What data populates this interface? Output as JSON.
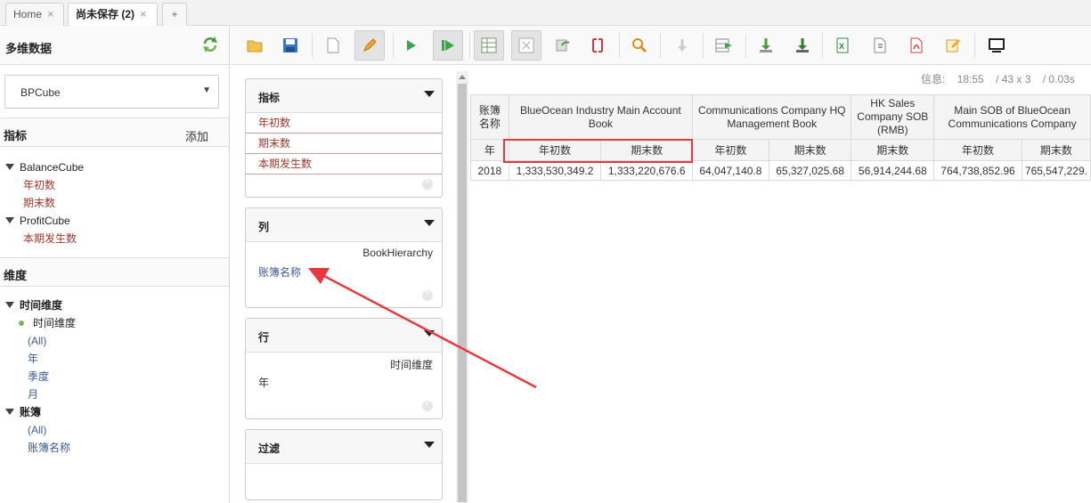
{
  "tabs": [
    {
      "label": "Home",
      "active": false
    },
    {
      "label": "尚未保存 (2)",
      "active": true
    }
  ],
  "tab_add": "+",
  "left": {
    "title": "多维数据",
    "cube_selected": "BPCube",
    "measures_section": {
      "title": "指标",
      "add_label": "添加"
    },
    "cubes": [
      {
        "name": "BalanceCube",
        "measures": [
          "年初数",
          "期末数"
        ]
      },
      {
        "name": "ProfitCube",
        "measures": [
          "本期发生数"
        ]
      }
    ],
    "dimensions_section": {
      "title": "维度"
    },
    "dimensions": [
      {
        "name": "时间维度",
        "hierarchy": "时间维度",
        "levels": [
          "(All)",
          "年",
          "季度",
          "月"
        ]
      },
      {
        "name": "账簿",
        "levels": [
          "(All)",
          "账簿名称"
        ]
      }
    ]
  },
  "axes": {
    "measures": {
      "title": "指标",
      "items": [
        "年初数",
        "期末数",
        "本期发生数"
      ]
    },
    "columns": {
      "title": "列",
      "hierarchy": "BookHierarchy",
      "level": "账簿名称"
    },
    "rows": {
      "title": "行",
      "hierarchy": "时间维度",
      "level": "年"
    },
    "filter": {
      "title": "过滤"
    }
  },
  "info": {
    "label": "信息:",
    "time": "18:55",
    "size": "/  43 x 3",
    "duration": "/  0.03s"
  },
  "grid": {
    "corner_top": "账簿名称",
    "corner_sub": "年",
    "books": [
      {
        "name": "BlueOcean Industry Main Account Book",
        "span": 2
      },
      {
        "name": "Communications Company HQ Management Book",
        "span": 2
      },
      {
        "name": "HK Sales Company SOB (RMB)",
        "span": 1
      },
      {
        "name": "Main SOB of BlueOcean Communications Company",
        "span": 2
      }
    ],
    "measure_headers": [
      "年初数",
      "期末数",
      "年初数",
      "期末数",
      "期末数",
      "年初数",
      "期末数"
    ],
    "rows": [
      {
        "label": "2018",
        "values": [
          "1,333,530,349.2",
          "1,333,220,676.6",
          "64,047,140.8",
          "65,327,025.68",
          "56,914,244.68",
          "764,738,852.96",
          "765,547,229."
        ]
      }
    ]
  },
  "colors": {
    "measure_text": "#a0372c",
    "member_text": "#3b5c93",
    "highlight": "#e8383d"
  }
}
